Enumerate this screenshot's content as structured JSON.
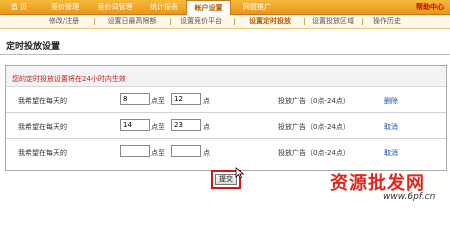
{
  "topnav": {
    "tabs": [
      {
        "label": "首 页"
      },
      {
        "label": "竞价管理"
      },
      {
        "label": "竞价词管理"
      },
      {
        "label": "统计报表"
      },
      {
        "label": "帐户设置"
      },
      {
        "label": "网盟推广"
      }
    ],
    "help_label": "帮助中心"
  },
  "subnav": {
    "items": [
      {
        "label": "修改/注册"
      },
      {
        "label": "设置日最高限额"
      },
      {
        "label": "设置竞价平台"
      },
      {
        "label": "设置定时投放"
      },
      {
        "label": "设置投放区域"
      },
      {
        "label": "操作历史"
      }
    ]
  },
  "page_title": "定时投放设置",
  "panel": {
    "note": "您的定时投放设置将在24小时内生效",
    "rows": [
      {
        "label": "我希望在每天的",
        "start": "8",
        "to": "点至",
        "end": "12",
        "hour": "点",
        "status": "投放广告（0点-24点）",
        "action": "删除"
      },
      {
        "label": "我希望在每天的",
        "start": "14",
        "to": "点至",
        "end": "23",
        "hour": "点",
        "status": "投放广告（0点-24点）",
        "action": "取消"
      },
      {
        "label": "我希望在每天的",
        "start": "",
        "to": "点至",
        "end": "",
        "hour": "点",
        "status": "投放广告（0点-24点）",
        "action": "取消"
      }
    ]
  },
  "submit_label": "提交",
  "watermark": {
    "text": "资源批发网",
    "url": "www.6pf.cn"
  },
  "colors": {
    "nav": "#f0a531",
    "accent": "#c05a00",
    "note": "#c81b1b",
    "highlight": "#d01818",
    "link": "#1a4fb0"
  }
}
